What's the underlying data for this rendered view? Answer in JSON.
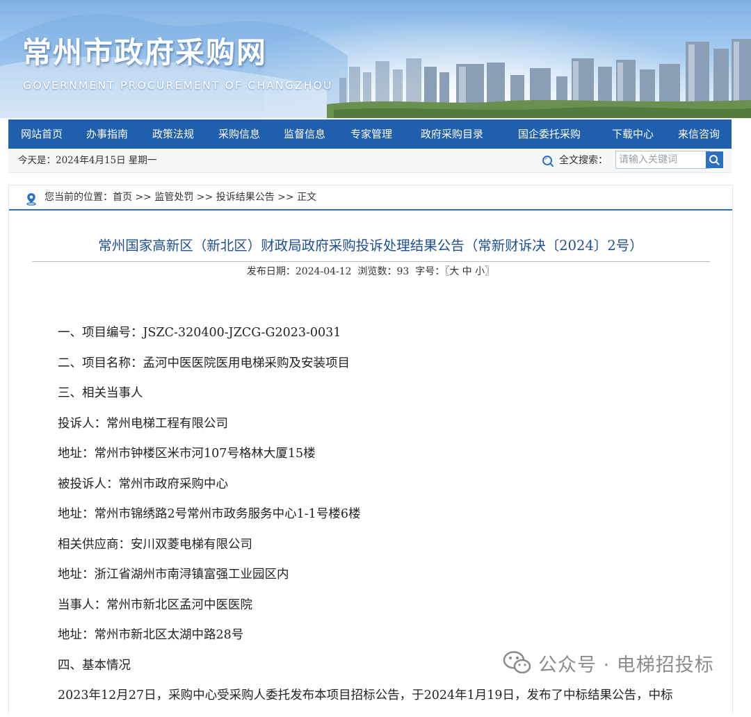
{
  "header": {
    "site_title": "常州市政府采购网",
    "site_subtitle": "GOVERNMENT PROCUREMENT OF CHANGZHOU"
  },
  "nav": {
    "items": [
      {
        "label": "网站首页"
      },
      {
        "label": "办事指南"
      },
      {
        "label": "政策法规"
      },
      {
        "label": "采购信息"
      },
      {
        "label": "监督信息"
      },
      {
        "label": "专家管理"
      },
      {
        "label": "政府采购目录"
      },
      {
        "label": "国企委托采购"
      },
      {
        "label": "下载中心"
      },
      {
        "label": "来信咨询"
      }
    ]
  },
  "datebar": {
    "date_text": "今天是：2024年4月15日 星期一",
    "search_label": "全文搜索：",
    "search_placeholder": "请输入关键词",
    "search_value": ""
  },
  "breadcrumb": {
    "text": "您当前的位置：首页 >> 监管处罚 >> 投诉结果公告 >> 正文"
  },
  "article": {
    "title": "常州国家高新区（新北区）财政局政府采购投诉处理结果公告（常新财诉决〔2024〕2号）",
    "meta": "发布日期：2024-04-12  浏览数：93  字号：〖大 中 小〗",
    "lines": [
      "一、项目编号：JSZC-320400-JZCG-G2023-0031",
      "二、项目名称：孟河中医医院医用电梯采购及安装项目",
      "三、相关当事人",
      "投诉人：常州电梯工程有限公司",
      "地址：常州市钟楼区米市河107号格林大厦15楼",
      "被投诉人：常州市政府采购中心",
      "地址：常州市锦绣路2号常州市政务服务中心1-1号楼6楼",
      "相关供应商：安川双菱电梯有限公司",
      "地址：浙江省湖州市南浔镇富强工业园区内",
      "当事人：常州市新北区孟河中医医院",
      "地址：常州市新北区太湖中路28号",
      "四、基本情况",
      "2023年12月27日，采购中心受采购人委托发布本项目招标公告，于2024年1月19日，发布了中标结果公告，中标"
    ]
  },
  "watermark": {
    "text": "公众号 · 电梯招投标",
    "icon": "wechat-icon"
  },
  "colors": {
    "nav_bg": "#1f5fae",
    "title_color": "#1f4f93",
    "accent": "#2d6fc3"
  }
}
